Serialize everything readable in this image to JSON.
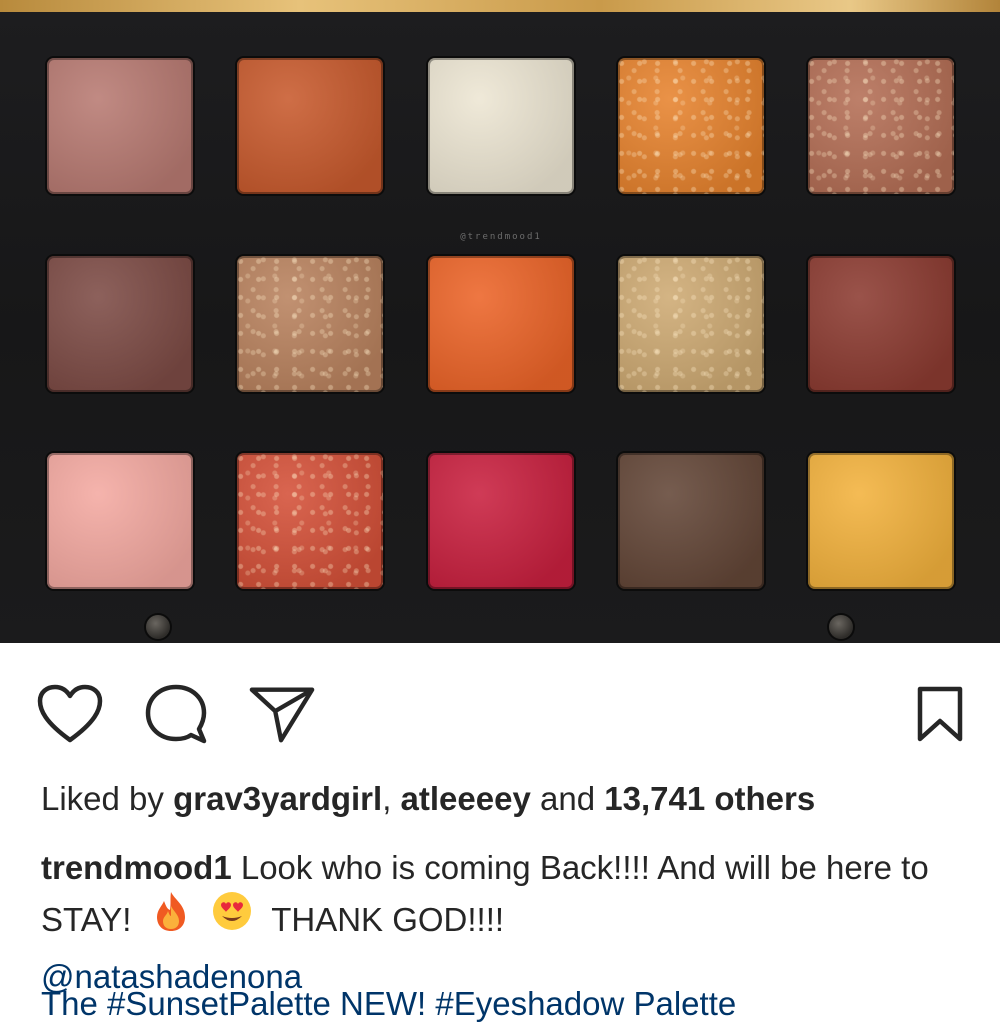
{
  "post": {
    "watermark": "@trendmood1",
    "palette": {
      "rows": [
        [
          "#b87a72",
          "#c85a2d",
          "#ede6d3",
          "#e7832e",
          "#b46e55"
        ],
        [
          "#7d4b45",
          "#b9825e",
          "#ec6428",
          "#ceaa73",
          "#8c3b31"
        ],
        [
          "#f4a9a1",
          "#d45038",
          "#c9203f",
          "#634637",
          "#f3b23d"
        ]
      ],
      "shimmer": [
        [
          false,
          false,
          false,
          true,
          true
        ],
        [
          false,
          true,
          false,
          true,
          false
        ],
        [
          false,
          true,
          false,
          false,
          false
        ]
      ]
    }
  },
  "actions": {
    "like": "heart-icon",
    "comment": "comment-icon",
    "share": "paper-plane-icon",
    "save": "bookmark-icon"
  },
  "likes": {
    "prefix": "Liked by ",
    "user1": "grav3yardgirl",
    "separator": ", ",
    "user2": "atleeeey",
    "middle": " and ",
    "others": "13,741 others"
  },
  "caption": {
    "username": "trendmood1",
    "text": " Look who is coming Back!!!! And will be here to STAY!",
    "emoji_fire": "🔥",
    "emoji_heart_eyes": "😍",
    "text2": " THANK GOD!!!!",
    "mention": "@natashadenona"
  },
  "next_line": "The #SunsetPalette NEW! #Eyeshadow Palette"
}
